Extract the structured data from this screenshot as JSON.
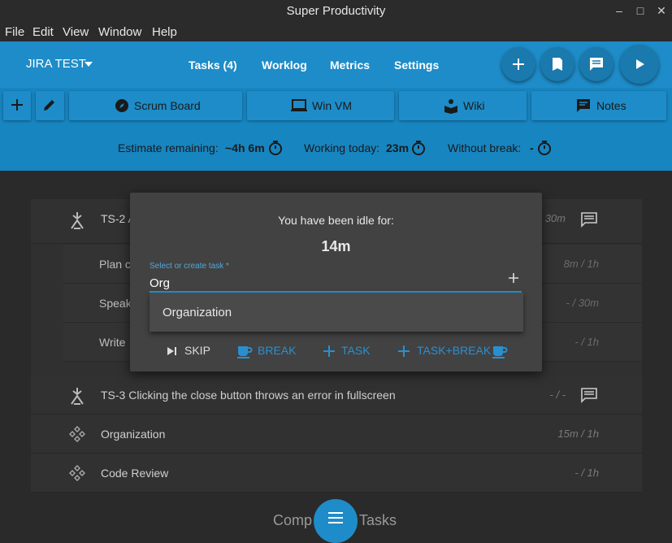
{
  "app": {
    "title": "Super Productivity"
  },
  "window_controls": {
    "minimize": "–",
    "maximize": "□",
    "close": "✕"
  },
  "menu": [
    "File",
    "Edit",
    "View",
    "Window",
    "Help"
  ],
  "header": {
    "project": "JIRA TEST",
    "nav": [
      "Tasks (4)",
      "Worklog",
      "Metrics",
      "Settings"
    ],
    "actions": [
      "add-icon",
      "bookmark-icon",
      "chat-icon",
      "play-icon"
    ]
  },
  "toolbar": {
    "buttons": [
      {
        "label": "Scrum Board",
        "icon": "compass-icon"
      },
      {
        "label": "Win VM",
        "icon": "laptop-icon"
      },
      {
        "label": "Wiki",
        "icon": "reader-icon"
      },
      {
        "label": "Notes",
        "icon": "notes-icon"
      }
    ],
    "stats": {
      "estimate_label": "Estimate remaining:",
      "estimate_value": "~4h 6m",
      "working_label": "Working today:",
      "working_value": "23m",
      "break_label": "Without break:",
      "break_value": "-"
    }
  },
  "tasks": [
    {
      "title": "TS-2 A",
      "time": "30m",
      "type": "jira"
    },
    {
      "title": "Plan c",
      "time": "8m / 1h",
      "type": "sub"
    },
    {
      "title": "Speak",
      "time": "- / 30m",
      "type": "sub"
    },
    {
      "title": "Write",
      "time": "- / 1h",
      "type": "sub"
    },
    {
      "title": "TS-3 Clicking the close button throws an error in fullscreen",
      "time": "- / -",
      "type": "jira"
    },
    {
      "title": "Organization",
      "time": "15m / 1h",
      "type": "plain"
    },
    {
      "title": "Code Review",
      "time": "- / 1h",
      "type": "plain"
    }
  ],
  "bottom": {
    "left": "Comp",
    "right": "Tasks"
  },
  "idle_dialog": {
    "title": "You have been idle for:",
    "duration": "14m",
    "field_label": "Select or create task *",
    "field_value": "Org",
    "suggestion": "Organization",
    "actions": {
      "skip": "SKIP",
      "break": "BREAK",
      "task": "TASK",
      "task_break": "TASK+BREAK"
    }
  },
  "colors": {
    "accent": "#1e8cc8",
    "dialog_bg": "#424242",
    "background": "#2a2a2a"
  }
}
